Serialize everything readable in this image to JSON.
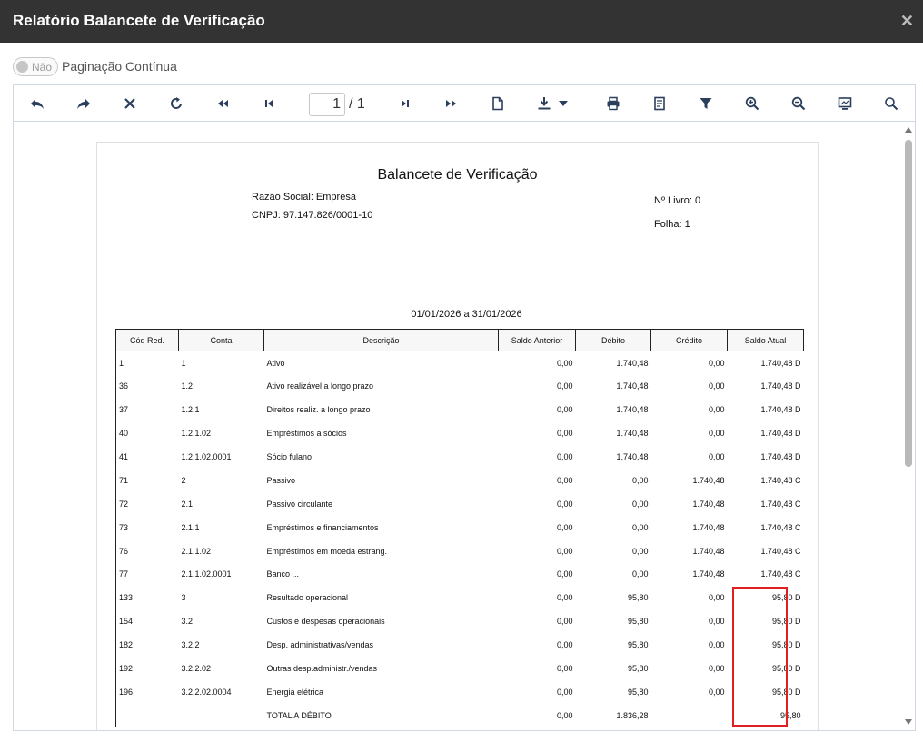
{
  "window": {
    "title": "Relatório Balancete de Verificação",
    "close_glyph": "✕"
  },
  "pagination": {
    "toggle_label": "Não",
    "label": "Paginação Contínua"
  },
  "toolbar": {
    "current_page": "1",
    "page_separator": "/ 1",
    "icons": [
      "undo-icon",
      "redo-icon",
      "close-icon",
      "refresh-icon",
      "first-page-icon",
      "previous-page-icon",
      "next-page-icon",
      "last-page-icon",
      "document-icon",
      "download-icon",
      "print-icon",
      "print-layout-icon",
      "filter-icon",
      "zoom-in-icon",
      "zoom-out-icon",
      "fullscreen-icon",
      "search-icon"
    ]
  },
  "report": {
    "title": "Balancete de Verificação",
    "company": "Razão Social: Empresa",
    "cnpj": "CNPJ: 97.147.826/0001-10",
    "book_number": "Nº Livro: 0",
    "sheet": "Folha: 1",
    "period": "01/01/2026 a 31/01/2026",
    "columns": [
      "Cód Red.",
      "Conta",
      "Descrição",
      "Saldo Anterior",
      "Débito",
      "Crédito",
      "Saldo Atual"
    ],
    "rows": [
      [
        "1",
        "1",
        "Ativo",
        "0,00",
        "1.740,48",
        "0,00",
        "1.740,48 D"
      ],
      [
        "36",
        "1.2",
        "Ativo realizável a longo prazo",
        "0,00",
        "1.740,48",
        "0,00",
        "1.740,48 D"
      ],
      [
        "37",
        "1.2.1",
        "Direitos realiz. a longo prazo",
        "0,00",
        "1.740,48",
        "0,00",
        "1.740,48 D"
      ],
      [
        "40",
        "1.2.1.02",
        "Empréstimos a sócios",
        "0,00",
        "1.740,48",
        "0,00",
        "1.740,48 D"
      ],
      [
        "41",
        "1.2.1.02.0001",
        "Sócio fulano",
        "0,00",
        "1.740,48",
        "0,00",
        "1.740,48 D"
      ],
      [
        "71",
        "2",
        "Passivo",
        "0,00",
        "0,00",
        "1.740,48",
        "1.740,48 C"
      ],
      [
        "72",
        "2.1",
        "Passivo circulante",
        "0,00",
        "0,00",
        "1.740,48",
        "1.740,48 C"
      ],
      [
        "73",
        "2.1.1",
        "Empréstimos e financiamentos",
        "0,00",
        "0,00",
        "1.740,48",
        "1.740,48 C"
      ],
      [
        "76",
        "2.1.1.02",
        "Empréstimos em moeda estrang.",
        "0,00",
        "0,00",
        "1.740,48",
        "1.740,48 C"
      ],
      [
        "77",
        "2.1.1.02.0001",
        "Banco ...",
        "0,00",
        "0,00",
        "1.740,48",
        "1.740,48 C"
      ],
      [
        "133",
        "3",
        "Resultado operacional",
        "0,00",
        "95,80",
        "0,00",
        "95,80 D"
      ],
      [
        "154",
        "3.2",
        "Custos e despesas operacionais",
        "0,00",
        "95,80",
        "0,00",
        "95,80 D"
      ],
      [
        "182",
        "3.2.2",
        "Desp. administrativas/vendas",
        "0,00",
        "95,80",
        "0,00",
        "95,80 D"
      ],
      [
        "192",
        "3.2.2.02",
        "Outras desp.administr./vendas",
        "0,00",
        "95,80",
        "0,00",
        "95,80 D"
      ],
      [
        "196",
        "3.2.2.02.0004",
        "Energia elétrica",
        "0,00",
        "95,80",
        "0,00",
        "95,80 D"
      ],
      [
        "",
        "",
        "TOTAL A DÉBITO",
        "0,00",
        "1.836,28",
        "",
        "95,80"
      ]
    ]
  },
  "colors": {
    "titlebar": "#333333",
    "toolbar_icon": "#2b3f5c",
    "highlight": "#e02020"
  }
}
